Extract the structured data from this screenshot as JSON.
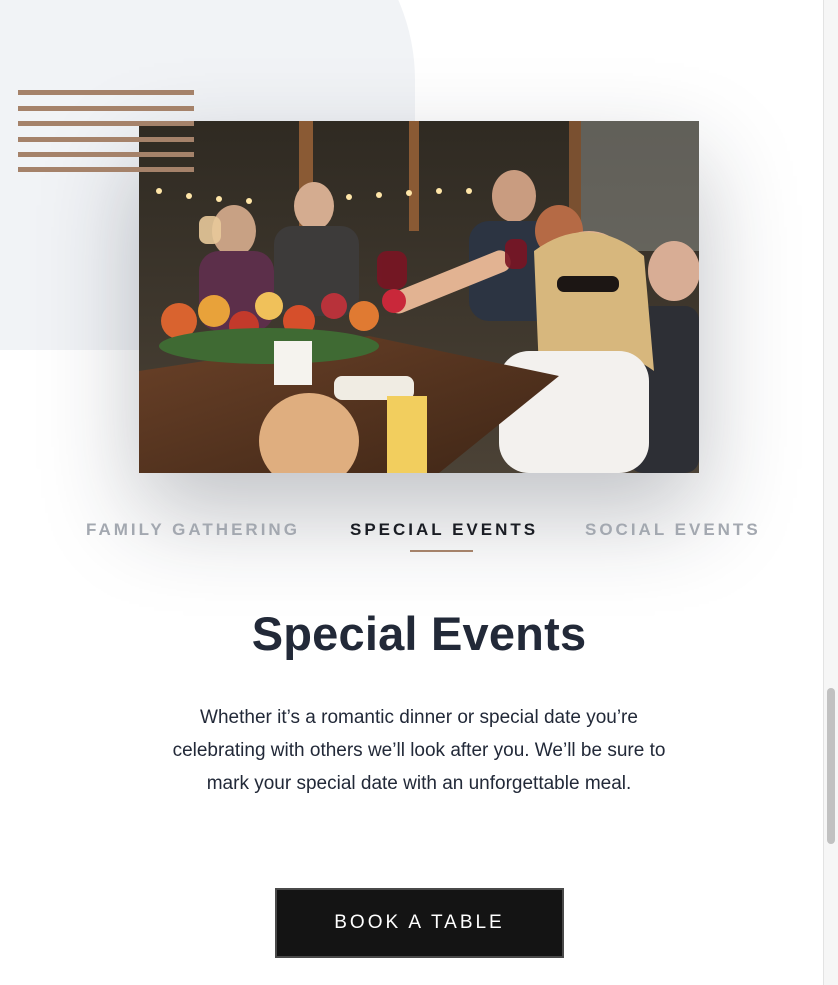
{
  "tabs": {
    "items": [
      {
        "label": "FAMILY GATHERING",
        "active": false
      },
      {
        "label": "SPECIAL EVENTS",
        "active": true
      },
      {
        "label": "SOCIAL EVENTS",
        "active": false
      }
    ]
  },
  "section": {
    "title": "Special Events",
    "description": "Whether it’s a romantic dinner or special date you’re celebrating with others we’ll look after you. We’ll be sure to mark your special date with an unforgettable meal.",
    "cta_label": "BOOK A TABLE"
  },
  "colors": {
    "accent": "#a5826a",
    "heading": "#222938",
    "tab_inactive": "#a3a8b0",
    "button_bg": "#141414",
    "blob_bg": "#f1f3f6"
  },
  "icons": {
    "decor": "stripes-decoration"
  }
}
